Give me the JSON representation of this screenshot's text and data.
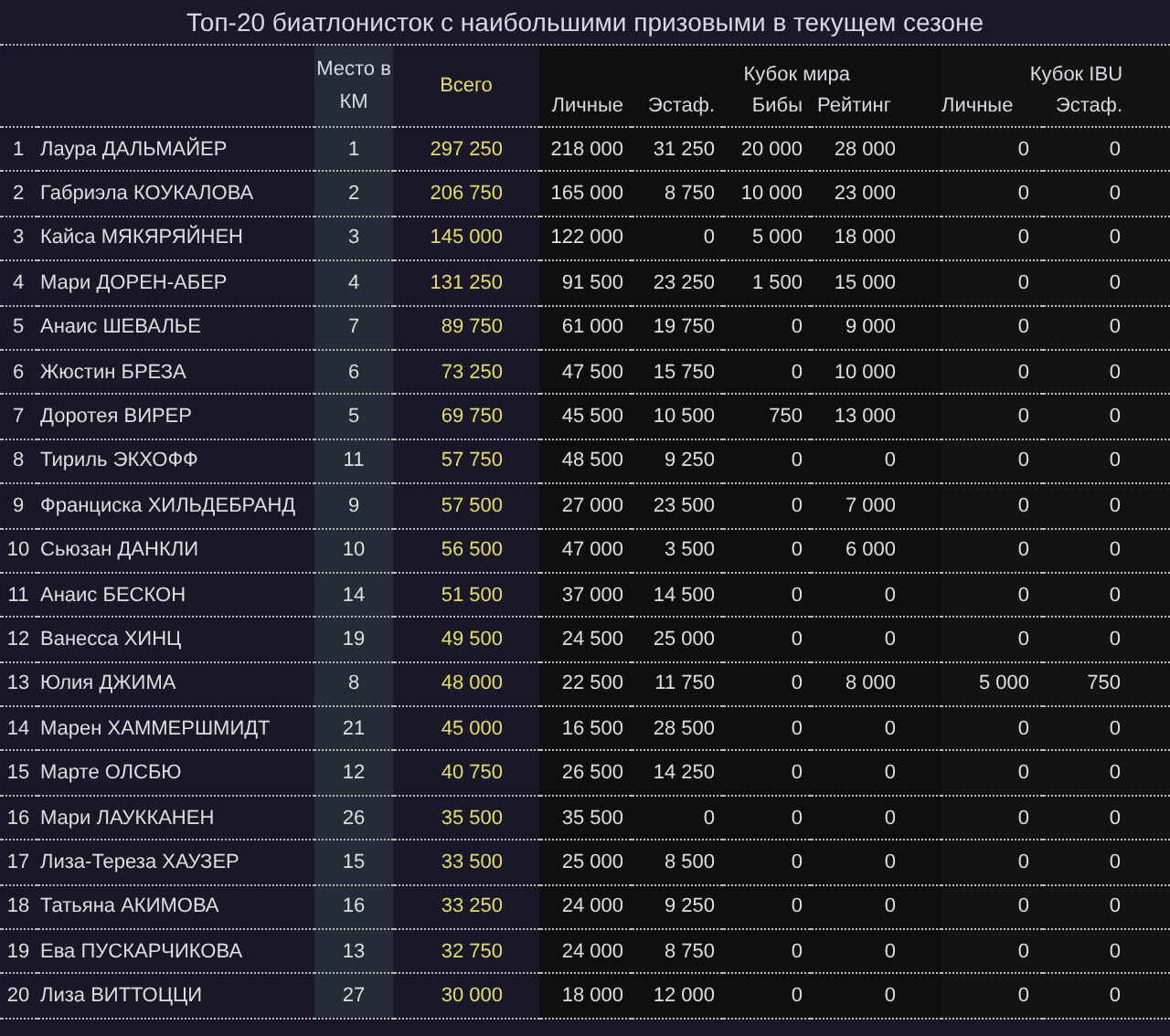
{
  "title": "Топ-20 биатлонисток с наибольшими призовыми в текущем сезоне",
  "header": {
    "place": "Место в КМ",
    "total": "Всего",
    "groups": [
      {
        "label": "Кубок мира",
        "columns": [
          "Личные",
          "Эстаф.",
          "Бибы",
          "Рейтинг"
        ]
      },
      {
        "label": "Кубок IBU",
        "columns": [
          "Личные",
          "Эстаф."
        ]
      }
    ]
  },
  "rows": [
    [
      "1",
      "Лаура ДАЛЬМАЙЕР",
      "1",
      "297 250",
      "218 000",
      "31 250",
      "20 000",
      "28 000",
      "0",
      "0"
    ],
    [
      "2",
      "Габриэла КОУКАЛОВА",
      "2",
      "206 750",
      "165 000",
      "8 750",
      "10 000",
      "23 000",
      "0",
      "0"
    ],
    [
      "3",
      "Кайса МЯКЯРЯЙНЕН",
      "3",
      "145 000",
      "122 000",
      "0",
      "5 000",
      "18 000",
      "0",
      "0"
    ],
    [
      "4",
      "Мари ДОРЕН-АБЕР",
      "4",
      "131 250",
      "91 500",
      "23 250",
      "1 500",
      "15 000",
      "0",
      "0"
    ],
    [
      "5",
      "Анаис ШЕВАЛЬЕ",
      "7",
      "89 750",
      "61 000",
      "19 750",
      "0",
      "9 000",
      "0",
      "0"
    ],
    [
      "6",
      "Жюстин БРЕЗА",
      "6",
      "73 250",
      "47 500",
      "15 750",
      "0",
      "10 000",
      "0",
      "0"
    ],
    [
      "7",
      "Доротея ВИРЕР",
      "5",
      "69 750",
      "45 500",
      "10 500",
      "750",
      "13 000",
      "0",
      "0"
    ],
    [
      "8",
      "Тириль ЭКХОФФ",
      "11",
      "57 750",
      "48 500",
      "9 250",
      "0",
      "0",
      "0",
      "0"
    ],
    [
      "9",
      "Франциска ХИЛЬДЕБРАНД",
      "9",
      "57 500",
      "27 000",
      "23 500",
      "0",
      "7 000",
      "0",
      "0"
    ],
    [
      "10",
      "Сьюзан ДАНКЛИ",
      "10",
      "56 500",
      "47 000",
      "3 500",
      "0",
      "6 000",
      "0",
      "0"
    ],
    [
      "11",
      "Анаис БЕСКОН",
      "14",
      "51 500",
      "37 000",
      "14 500",
      "0",
      "0",
      "0",
      "0"
    ],
    [
      "12",
      "Ванесса ХИНЦ",
      "19",
      "49 500",
      "24 500",
      "25 000",
      "0",
      "0",
      "0",
      "0"
    ],
    [
      "13",
      "Юлия ДЖИМА",
      "8",
      "48 000",
      "22 500",
      "11 750",
      "0",
      "8 000",
      "5 000",
      "750"
    ],
    [
      "14",
      "Марен ХАММЕРШМИДТ",
      "21",
      "45 000",
      "16 500",
      "28 500",
      "0",
      "0",
      "0",
      "0"
    ],
    [
      "15",
      "Марте ОЛСБЮ",
      "12",
      "40 750",
      "26 500",
      "14 250",
      "0",
      "0",
      "0",
      "0"
    ],
    [
      "16",
      "Мари ЛАУККАНЕН",
      "26",
      "35 500",
      "35 500",
      "0",
      "0",
      "0",
      "0",
      "0"
    ],
    [
      "17",
      "Лиза-Тереза ХАУЗЕР",
      "15",
      "33 500",
      "25 000",
      "8 500",
      "0",
      "0",
      "0",
      "0"
    ],
    [
      "18",
      "Татьяна АКИМОВА",
      "16",
      "33 250",
      "24 000",
      "9 250",
      "0",
      "0",
      "0",
      "0"
    ],
    [
      "19",
      "Ева ПУСКАРЧИКОВА",
      "13",
      "32 750",
      "24 000",
      "8 750",
      "0",
      "0",
      "0",
      "0"
    ],
    [
      "20",
      "Лиза ВИТТОЦЦИ",
      "27",
      "30 000",
      "18 000",
      "12 000",
      "0",
      "0",
      "0",
      "0"
    ]
  ]
}
